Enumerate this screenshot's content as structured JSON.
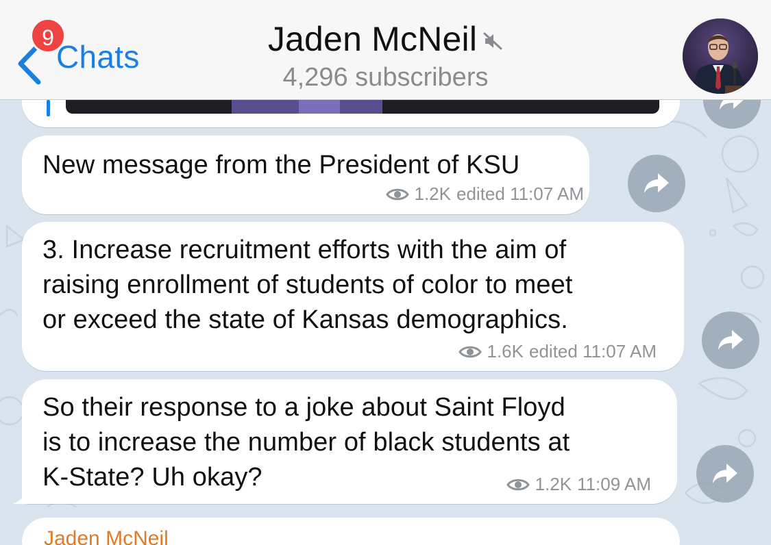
{
  "header": {
    "back_label": "Chats",
    "unread_badge": "9",
    "channel_title": "Jaden McNeil",
    "subscribers": "4,296 subscribers"
  },
  "messages": [
    {
      "text": "New message from the President of KSU",
      "views": "1.2K",
      "status": "edited 11:07 AM"
    },
    {
      "text": "3. Increase recruitment efforts with the aim of raising enrollment of students of color to meet or exceed the state of Kansas demographics.",
      "lines": [
        "3. Increase recruitment efforts with the aim of",
        "raising enrollment of students of color to meet",
        "or exceed the state of Kansas demographics."
      ],
      "views": "1.6K",
      "status": "edited 11:07 AM"
    },
    {
      "text": "So their response to a joke about Saint Floyd is to increase the number of black students at K-State? Uh okay?",
      "lines": [
        "So their response to a joke about Saint Floyd",
        "is to increase the number of black students at",
        "K-State? Uh okay?"
      ],
      "views": "1.2K",
      "status": "11:09 AM"
    }
  ],
  "next_message": {
    "sender": "Jaden McNeil"
  },
  "colors": {
    "accent": "#1a7fe0",
    "badge": "#ef4343",
    "sender_name": "#e07b28",
    "background": "#d9e4ee"
  },
  "icons": {
    "back": "chevron-left-icon",
    "mute": "speaker-muted-icon",
    "views": "eye-icon",
    "share": "share-arrow-icon"
  }
}
